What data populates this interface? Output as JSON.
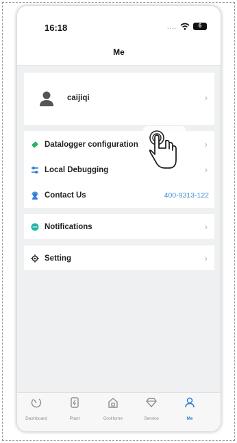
{
  "status_bar": {
    "time": "16:18",
    "signal_dots": "....",
    "battery": "6"
  },
  "header": {
    "title": "Me"
  },
  "profile": {
    "username": "caijiqi"
  },
  "menu": {
    "datalogger": "Datalogger configuration",
    "local_debugging": "Local Debugging",
    "contact_us": "Contact Us",
    "contact_phone": "400-9313-122",
    "notifications": "Notifications",
    "setting": "Setting"
  },
  "chevron": "›",
  "tabs": [
    {
      "label": "Dashboard",
      "icon": "dashboard-icon"
    },
    {
      "label": "Plant",
      "icon": "plant-icon"
    },
    {
      "label": "GroHome",
      "icon": "grohome-icon"
    },
    {
      "label": "Service",
      "icon": "service-icon"
    },
    {
      "label": "Me",
      "icon": "me-icon"
    }
  ],
  "colors": {
    "accent": "#2f7bd9",
    "link": "#3b8fd6",
    "datalogger_icon": "#2cae6b",
    "debug_icon": "#2f7bd9",
    "contact_icon": "#2f7bd9",
    "notification_icon": "#1fb5a8",
    "setting_icon": "#333333"
  }
}
